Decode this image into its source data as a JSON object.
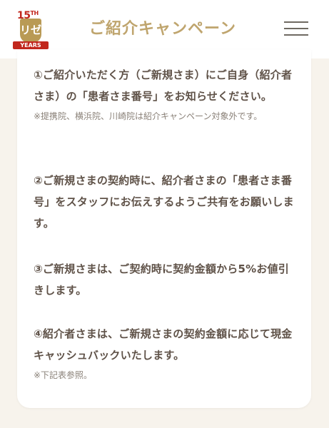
{
  "header": {
    "logo": {
      "anniversary": "15",
      "suffix": "TH",
      "brand": "リゼ",
      "ribbon": "YEARS"
    },
    "title": "ご紹介キャンペーン",
    "menu_icon": "hamburger-menu-icon"
  },
  "items": [
    {
      "text": "①ご紹介いただく方（ご新規さま）にご自身（紹介者さま）の「患者さま番号」をお知らせください。",
      "note": "※提携院、横浜院、川崎院は紹介キャンペーン対象外です。"
    },
    {
      "text": "②ご新規さまの契約時に、紹介者さまの「患者さま番号」をスタッフにお伝えするようご共有をお願いします。"
    },
    {
      "text": "③ご新規さまは、ご契約時に契約金額から5%お値引きします。"
    },
    {
      "text": "④紹介者さまは、ご新規さまの契約金額に応じて現金キャッシュバックいたします。",
      "note": "※下記表参照。"
    }
  ],
  "colors": {
    "title": "#bfa56e",
    "body_text": "#5f5248",
    "note_text": "#8a8178",
    "background": "#f7f3ec",
    "logo_red": "#c1271d",
    "logo_gold": "#b99a55"
  }
}
